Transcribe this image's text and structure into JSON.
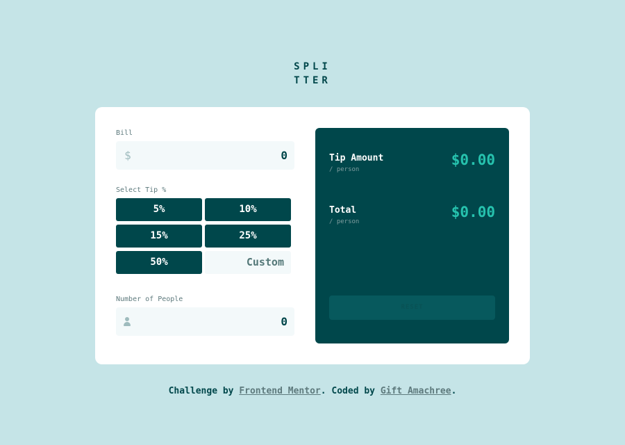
{
  "app": {
    "logo_line1": "SPLI",
    "logo_line2": "TTER"
  },
  "bill": {
    "label": "Bill",
    "currency_symbol": "$",
    "value": "0"
  },
  "tip": {
    "label": "Select Tip %",
    "options": [
      "5%",
      "10%",
      "15%",
      "25%",
      "50%"
    ],
    "custom_placeholder": "Custom"
  },
  "people": {
    "label": "Number of People",
    "value": "0",
    "icon": "person-icon"
  },
  "results": {
    "tip_amount_label": "Tip Amount",
    "tip_amount_sub": "/ person",
    "tip_amount_value": "$0.00",
    "total_label": "Total",
    "total_sub": "/ person",
    "total_value": "$0.00",
    "reset_label": "RESET"
  },
  "footer": {
    "prefix": "Challenge by ",
    "link1": "Frontend Mentor",
    "middle": ". Coded by ",
    "link2": "Gift Amachree",
    "suffix": "."
  },
  "colors": {
    "background": "#c5e4e7",
    "primary_dark": "#00474b",
    "accent": "#26c2ae",
    "input_bg": "#f3f9fa"
  }
}
